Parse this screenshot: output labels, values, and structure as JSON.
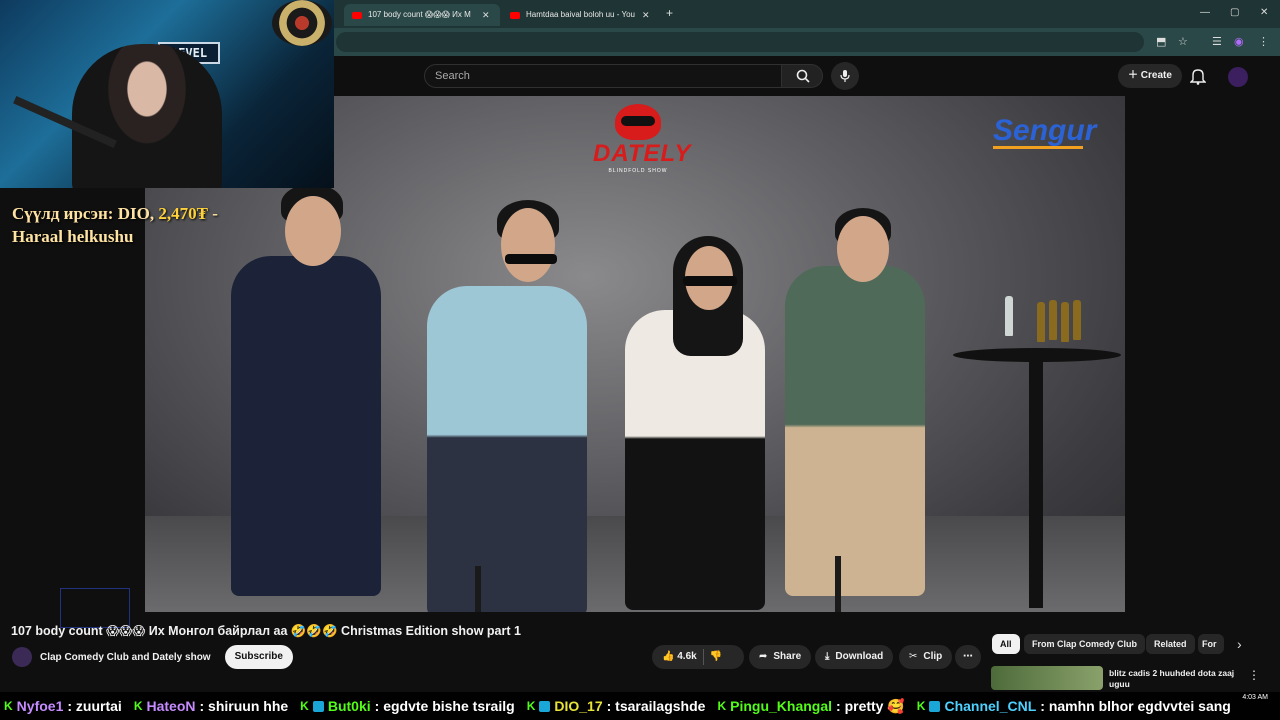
{
  "browser": {
    "tabs": [
      {
        "label": "107 body count 😱😱😱 Их М",
        "active": true
      },
      {
        "label": "Hamtdaa baival boloh uu - You",
        "active": false
      }
    ],
    "new_tab": "+",
    "window_controls": [
      "—",
      "▢",
      "✕"
    ]
  },
  "youtube": {
    "search": {
      "placeholder": "Search"
    },
    "create_label": "Create"
  },
  "overlay": {
    "donation_line1": "Сүүлд ирсэн: DIO, ",
    "donation_amount": "2,470₮",
    "donation_dash": " -",
    "donation_line2": "Haraal helkushu"
  },
  "video": {
    "logo_left": "DATELY",
    "logo_left_sub": "BLINDFOLD SHOW",
    "logo_right": "Sengur",
    "title": "107 body count 😱😱😱 Их Монгол байрлал аа 🤣🤣🤣 Christmas Edition show part 1",
    "channel": "Clap Comedy Club and Dately show",
    "subscribe": "Subscribe",
    "likes": "4.6k",
    "share": "Share",
    "download": "Download",
    "clip": "Clip",
    "more": "⋯"
  },
  "sidebar": {
    "chips": [
      "All",
      "From Clap Comedy Club",
      "Related",
      "For"
    ],
    "rec_title": "blitz cadis 2 huuhded dota zaaj uguu"
  },
  "chat": [
    {
      "user": "Nyfoe1",
      "text": ": zuurtai",
      "color": "#c58bff"
    },
    {
      "user": "HateoN",
      "text": ": shiruun hhe",
      "color": "#c58bff"
    },
    {
      "user": "But0ki",
      "text": ": egdvte bishe tsrailg",
      "color": "#53fc18"
    },
    {
      "user": "DIO_17",
      "text": ": tsarailagshde",
      "color": "#e8e33a"
    },
    {
      "user": "Pingu_Khangal",
      "text": ": pretty 🥰",
      "color": "#53fc18"
    },
    {
      "user": "Channel_CNL",
      "text": ": namhn blhor egdvvtei sang",
      "color": "#4fd1ff"
    }
  ],
  "clock": "4:03 AM",
  "colors": {
    "accent": "#ff0000",
    "chrome": "#1f3434",
    "kick_green": "#53fc18"
  }
}
